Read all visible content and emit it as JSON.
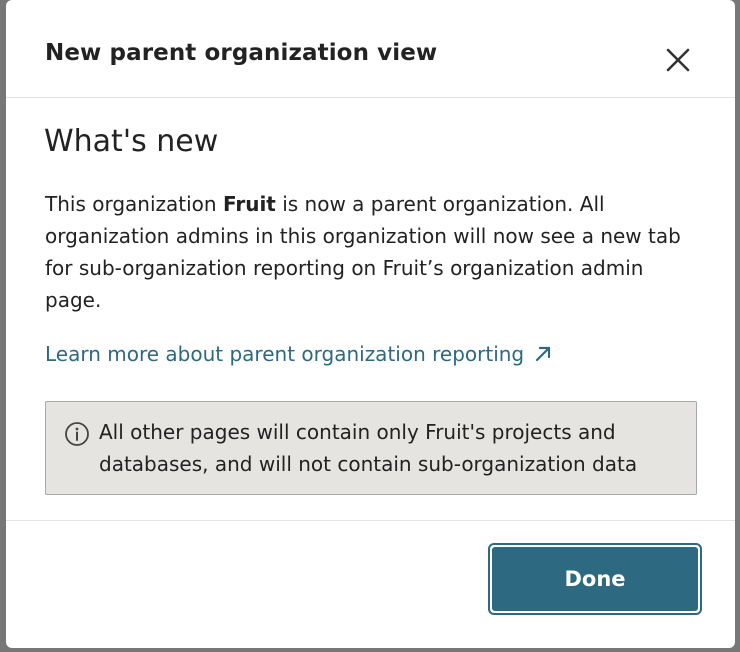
{
  "dialog": {
    "title": "New parent organization view",
    "close_icon": "close-icon"
  },
  "content": {
    "heading": "What's new",
    "description_prefix": "This organization ",
    "org_name": "Fruit",
    "description_suffix": " is now a parent organization. All organization admins in this organization will now see a new tab for sub-organization reporting on Fruit’s organization admin page.",
    "learn_more_link": "Learn more about parent organization reporting",
    "external_link_icon": "external-link-icon",
    "info_icon": "info-icon",
    "info_text": "All other pages will contain only Fruit's projects and databases, and will not contain sub-organization data"
  },
  "footer": {
    "done_label": "Done"
  },
  "colors": {
    "accent": "#2d6a82",
    "info_background": "#e5e4e1",
    "info_border": "#a9a9a6",
    "text": "#222222"
  }
}
